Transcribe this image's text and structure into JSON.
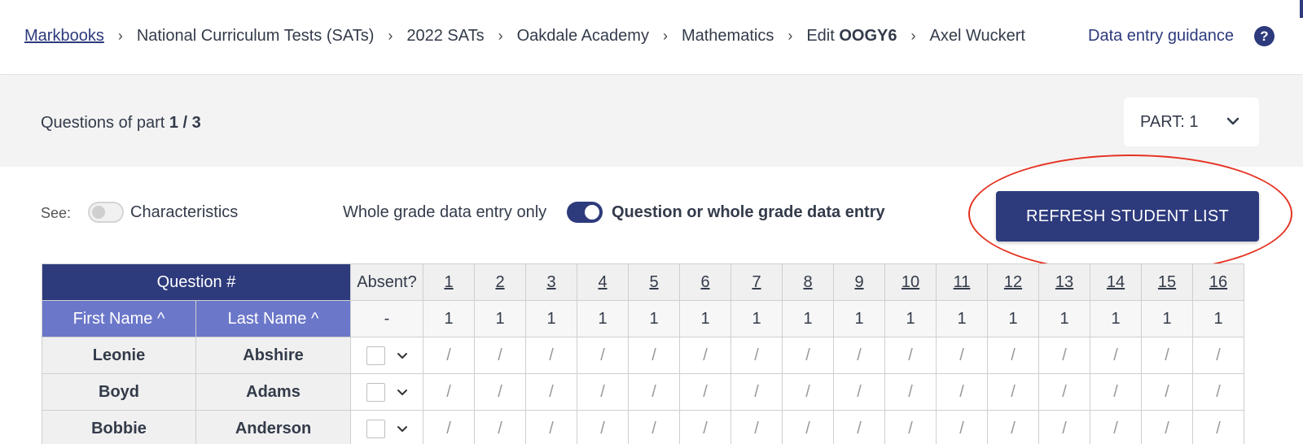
{
  "breadcrumb": {
    "items": [
      "Markbooks",
      "National Curriculum Tests (SATs)",
      "2022 SATs",
      "Oakdale Academy",
      "Mathematics"
    ],
    "edit_prefix": "Edit",
    "edit_code": "OOGY6",
    "student": "Axel Wuckert",
    "separator": "›"
  },
  "header": {
    "guidance_label": "Data entry guidance",
    "help_glyph": "?"
  },
  "part": {
    "label_prefix": "Questions of part",
    "current": "1 / 3",
    "select_value": "PART: 1"
  },
  "controls": {
    "see_label": "See:",
    "characteristics_label": "Characteristics",
    "characteristics_on": false,
    "whole_grade_label": "Whole grade data entry only",
    "question_mode_label": "Question or whole grade data entry",
    "question_mode_on": true,
    "refresh_label": "REFRESH STUDENT LIST"
  },
  "table": {
    "question_header": "Question #",
    "absent_header": "Absent?",
    "first_name_header": "First Name ^",
    "last_name_header": "Last Name ^",
    "absent_marks": "-",
    "questions": [
      "1",
      "2",
      "3",
      "4",
      "5",
      "6",
      "7",
      "8",
      "9",
      "10",
      "11",
      "12",
      "13",
      "14",
      "15",
      "16"
    ],
    "max_marks": [
      "1",
      "1",
      "1",
      "1",
      "1",
      "1",
      "1",
      "1",
      "1",
      "1",
      "1",
      "1",
      "1",
      "1",
      "1",
      "1"
    ],
    "empty_mark": "/",
    "students": [
      {
        "first": "Leonie",
        "last": "Abshire"
      },
      {
        "first": "Boyd",
        "last": "Adams"
      },
      {
        "first": "Bobbie",
        "last": "Anderson"
      }
    ]
  },
  "colors": {
    "primary": "#2d3a7c",
    "name_header": "#6b77c9",
    "annotation": "#e53222"
  }
}
